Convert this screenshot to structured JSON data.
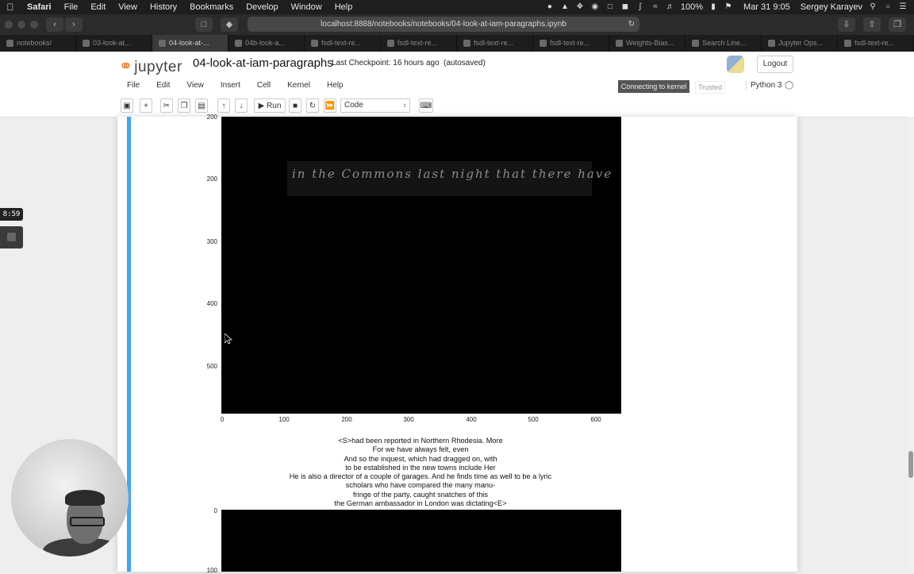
{
  "menubar": {
    "app": "Safari",
    "items": [
      "File",
      "Edit",
      "View",
      "History",
      "Bookmarks",
      "Develop",
      "Window",
      "Help"
    ],
    "battery": "100%",
    "datetime": "Mar 31  9:05",
    "user": "Sergey Karayev"
  },
  "browser": {
    "url": "localhost:8888/notebooks/notebooks/04-look-at-iam-paragraphs.ipynb",
    "tabs": [
      "notebooks/",
      "03-look-at...",
      "04-look-at-...",
      "04b-look-a...",
      "fsdl-text-re...",
      "fsdl-text-re...",
      "fsdl-text-re...",
      "fsdl-text-re...",
      "Weights-Bias...",
      "Search Line...",
      "Jupyter Ops...",
      "fsdl-text-re..."
    ],
    "active_tab": 2
  },
  "jupyter": {
    "logo": "jupyter",
    "notebook_title": "04-look-at-iam-paragraphs",
    "checkpoint": "Last Checkpoint: 16 hours ago",
    "autosaved": "(autosaved)",
    "logout": "Logout",
    "menu": [
      "File",
      "Edit",
      "View",
      "Insert",
      "Cell",
      "Kernel",
      "Help"
    ],
    "kernel_status": "Connecting to kernel",
    "trusted": "Trusted",
    "kernel_name": "Python 3",
    "run_label": "Run",
    "cell_type": "Code"
  },
  "plot1": {
    "y_ticks": [
      "200",
      "300",
      "400",
      "500"
    ],
    "y_top_partial": "200",
    "x_ticks": [
      "0",
      "100",
      "200",
      "300",
      "400",
      "500",
      "600"
    ],
    "handwriting": "in the Commons last night that there have"
  },
  "paragraph": [
    "<S>had been reported in Northern Rhodesia. More",
    "For we have always felt, even",
    "And so the inquest, which had dragged on, with",
    "to be established in the new towns include Her",
    "He is also a director of a couple of garages. And he finds time as well to be a lyric",
    "scholars who have compared the many manu-",
    "fringe of the party, caught snatches of this",
    "the German ambassador in London was dictating<E>"
  ],
  "plot2": {
    "y_ticks": [
      "0",
      "100"
    ]
  },
  "overlay": {
    "timer": "8:59"
  }
}
